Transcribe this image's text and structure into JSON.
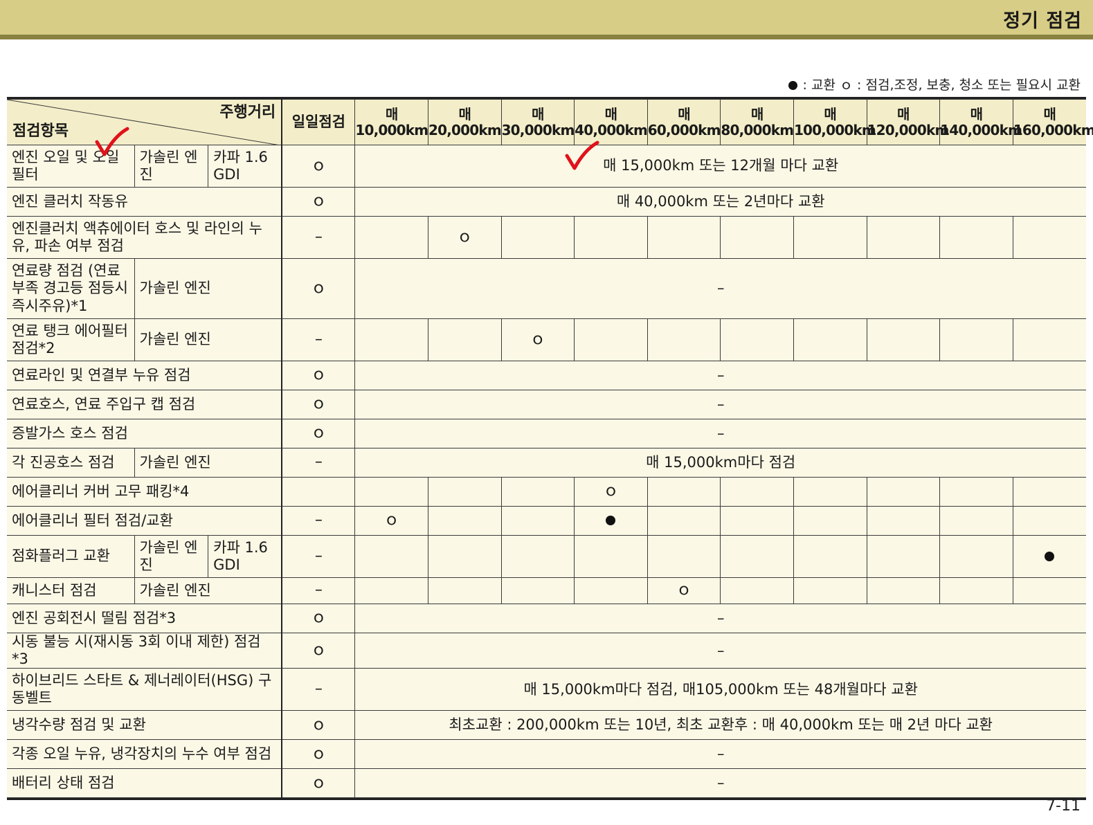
{
  "header": {
    "title": "정기 점검",
    "bar_color": "#d8cd86"
  },
  "legend": {
    "replace_label": ": 교환",
    "inspect_label": "ｏ : 점검,조정, 보충, 청소 또는 필요시 교환"
  },
  "table": {
    "corner": {
      "distance_label": "주행거리",
      "item_label": "점검항목"
    },
    "daily_label": "일일점검",
    "intervals": [
      {
        "top": "매",
        "bottom": "10,000km"
      },
      {
        "top": "매",
        "bottom": "20,000km"
      },
      {
        "top": "매",
        "bottom": "30,000km"
      },
      {
        "top": "매",
        "bottom": "40,000km"
      },
      {
        "top": "매",
        "bottom": "60,000km"
      },
      {
        "top": "매",
        "bottom": "80,000km"
      },
      {
        "top": "매",
        "bottom": "100,000km"
      },
      {
        "top": "매",
        "bottom": "120,000km"
      },
      {
        "top": "매",
        "bottom": "140,000km"
      },
      {
        "top": "매",
        "bottom": "160,000km"
      }
    ],
    "rows": [
      {
        "item": "엔진 오일 및 오일필터",
        "sub1": "가솔린 엔진",
        "sub2": "카파 1.6 GDI",
        "daily": "ｏ",
        "span_text": "매 15,000km 또는 12개월 마다 교환"
      },
      {
        "item": "엔진 클러치 작동유",
        "daily": "ｏ",
        "span_text": "매 40,000km 또는 2년마다 교환"
      },
      {
        "item": "엔진클러치 액츄에이터 호스 및 라인의 누유, 파손 여부 점검",
        "daily": "–",
        "cells": [
          "",
          "ｏ",
          "",
          "",
          "",
          "",
          "",
          "",
          "",
          ""
        ]
      },
      {
        "item": "연료량 점검 (연료부족 경고등 점등시즉시주유)*1",
        "sub": "가솔린 엔진",
        "daily": "ｏ",
        "span_text": "–"
      },
      {
        "item": "연료 탱크 에어필터 점검*2",
        "sub": "가솔린 엔진",
        "daily": "–",
        "cells": [
          "",
          "",
          "ｏ",
          "",
          "",
          "",
          "",
          "",
          "",
          ""
        ]
      },
      {
        "item": "연료라인 및 연결부 누유 점검",
        "daily": "ｏ",
        "span_text": "–"
      },
      {
        "item": "연료호스, 연료 주입구 캡 점검",
        "daily": "ｏ",
        "span_text": "–"
      },
      {
        "item": "증발가스 호스 점검",
        "daily": "ｏ",
        "span_text": "–"
      },
      {
        "item": "각 진공호스 점검",
        "sub": "가솔린 엔진",
        "daily": "–",
        "span_text": "매 15,000km마다 점검"
      },
      {
        "item": "에어클리너 커버 고무 패킹*4",
        "daily": "",
        "cells": [
          "",
          "",
          "",
          "ｏ",
          "",
          "",
          "",
          "",
          "",
          ""
        ]
      },
      {
        "item": "에어클리너 필터 점검/교환",
        "daily": "–",
        "cells": [
          "ｏ",
          "",
          "",
          "●",
          "",
          "",
          "",
          "",
          "",
          ""
        ]
      },
      {
        "item": "점화플러그 교환",
        "sub1": "가솔린 엔진",
        "sub2": "카파 1.6 GDI",
        "daily": "–",
        "cells": [
          "",
          "",
          "",
          "",
          "",
          "",
          "",
          "",
          "",
          "●"
        ]
      },
      {
        "item": "캐니스터 점검",
        "sub": "가솔린 엔진",
        "daily": "–",
        "cells": [
          "",
          "",
          "",
          "",
          "ｏ",
          "",
          "",
          "",
          "",
          ""
        ]
      },
      {
        "item": "엔진 공회전시 떨림 점검*3",
        "daily": "ｏ",
        "span_text": "–"
      },
      {
        "item": "시동 불능 시(재시동 3회 이내 제한) 점검*3",
        "daily": "ｏ",
        "span_text": "–"
      },
      {
        "item": "하이브리드 스타트 & 제너레이터(HSG) 구동벨트",
        "daily": "–",
        "span_text": "매 15,000km마다 점검, 매105,000km 또는 48개월마다 교환"
      },
      {
        "item": "냉각수량 점검 및 교환",
        "daily": "ｏ",
        "span_text": "최초교환 : 200,000km 또는 10년, 최초 교환후 : 매 40,000km 또는 매 2년 마다 교환"
      },
      {
        "item": "각종 오일 누유, 냉각장치의 누수 여부 점검",
        "daily": "ｏ",
        "span_text": "–"
      },
      {
        "item": "배터리 상태 점검",
        "daily": "ｏ",
        "span_text": "–"
      }
    ]
  },
  "annotations": {
    "check_color": "#e0121a"
  },
  "page_number": "7-11"
}
